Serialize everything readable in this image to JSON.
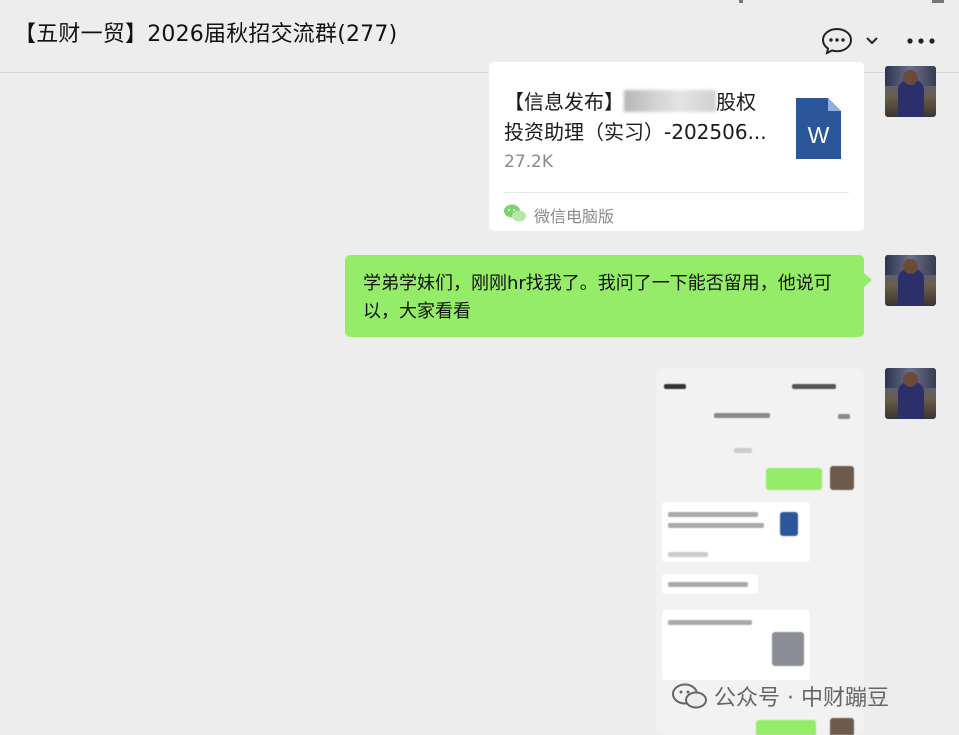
{
  "header": {
    "title": "【五财一贸】2026届秋招交流群(277)",
    "icons": [
      "chat-bubble-icon",
      "chevron-down-icon",
      "more-icon"
    ]
  },
  "messages": {
    "file_card": {
      "title_prefix": "【信息发布】",
      "title_suffix": "股权",
      "title_line2": "投资助理（实习）-202506...",
      "size": "27.2K",
      "source": "微信电脑版",
      "file_icon_letter": "W"
    },
    "text_message": {
      "text": "学弟学妹们，刚刚hr找我了。我问了一下能否留用，他说可以，大家看看"
    }
  },
  "watermark": {
    "text": "公众号 · 中财蹦豆"
  },
  "colors": {
    "bubble_green": "#95ec69",
    "background": "#ededed",
    "word_blue": "#2b579a"
  }
}
